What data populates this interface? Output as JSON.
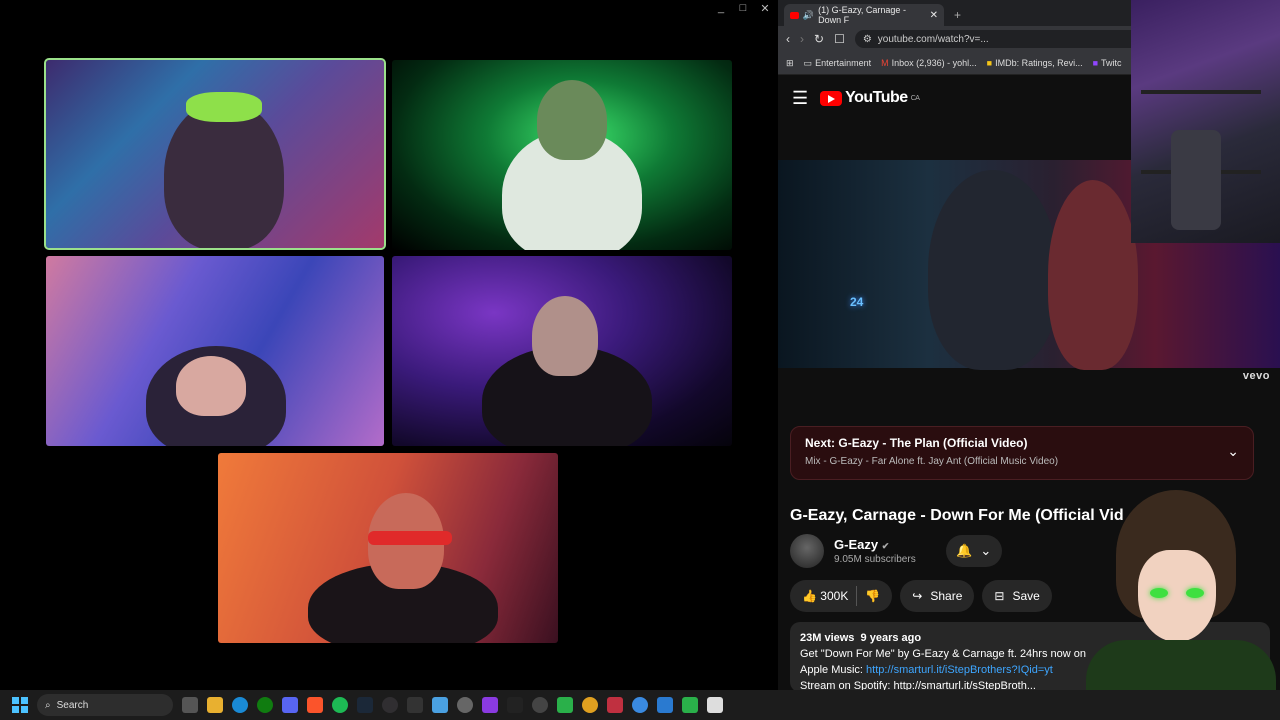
{
  "call": {
    "window_controls": [
      "_",
      "□",
      "✕"
    ]
  },
  "browser": {
    "tab_title": "(1) G-Eazy, Carnage - Down F",
    "tab_close": "✕",
    "new_tab": "+",
    "url": "youtube.com/watch?v=...",
    "bookmarks": [
      {
        "label": "Entertainment",
        "icon": "folder-icon"
      },
      {
        "label": "Inbox (2,936) - yohl...",
        "icon": "gmail-icon"
      },
      {
        "label": "IMDb: Ratings, Revi...",
        "icon": "imdb-icon"
      },
      {
        "label": "Twitc",
        "icon": "twitch-icon"
      }
    ]
  },
  "youtube": {
    "logo_text": "YouTube",
    "region": "CA",
    "vevo": "vevo",
    "video_sign": "24",
    "next": {
      "prefix": "Next:",
      "title": "G-Eazy - The Plan (Official Video)",
      "mix": "Mix - G-Eazy - Far Alone ft. Jay Ant (Official Music Video)"
    },
    "video_title": "G-Eazy, Carnage - Down For Me (Official Vid",
    "channel": {
      "name": "G-Eazy",
      "subscribers": "9.05M subscribers"
    },
    "likes": "300K",
    "share_label": "Share",
    "save_label": "Save",
    "description": {
      "views": "23M views",
      "age": "9 years ago",
      "line1": "Get \"Down For Me\" by G-Eazy & Carnage ft. 24hrs now on",
      "apple_label": "Apple Music:",
      "apple_link": "http://smarturl.it/iStepBrothers?IQid=yt",
      "line3": "Stream on Spotify: http://smarturl.it/sStepBroth..."
    }
  },
  "taskbar": {
    "search_label": "Search"
  },
  "colors": {
    "youtube_red": "#ff0000",
    "link_blue": "#3ea6ff",
    "active_speaker": "#9be08a"
  }
}
